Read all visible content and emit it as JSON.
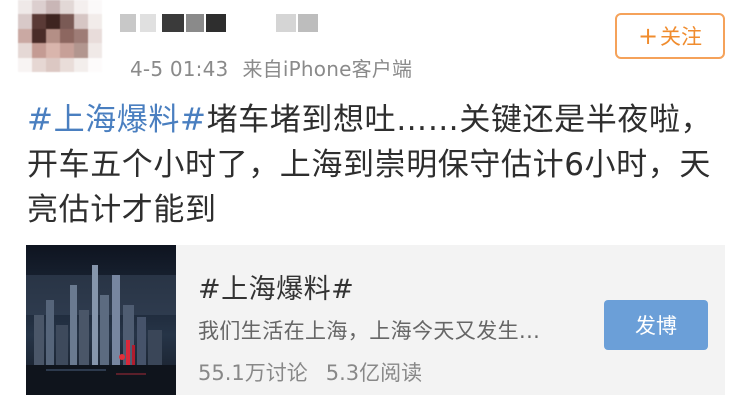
{
  "header": {
    "follow_label": "关注",
    "follow_plus": "+",
    "timestamp": "4-5 01:43",
    "source": "来自iPhone客户端"
  },
  "post": {
    "topic": "#上海爆料#",
    "text": "堵车堵到想吐……关键还是半夜啦，开车五个小时了，上海到崇明保守估计6小时，天亮估计才能到"
  },
  "card": {
    "title": "#上海爆料#",
    "description": "我们生活在上海，上海今天又发生...",
    "discussions": "55.1万讨论",
    "reads": "5.3亿阅读",
    "post_button": "发博"
  },
  "colors": {
    "topic_link": "#4a7fc0",
    "follow_orange": "#f08c2e",
    "post_button_blue": "#6b9fd8"
  }
}
